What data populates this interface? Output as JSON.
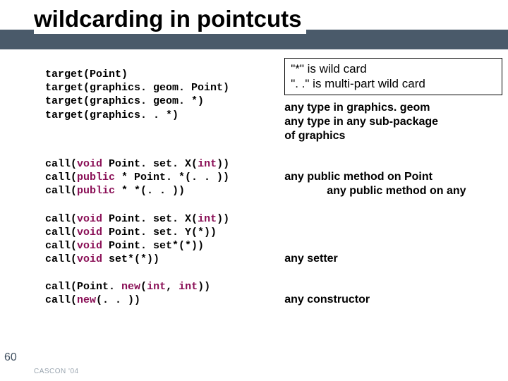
{
  "slide": {
    "title": "wildcarding in pointcuts",
    "number": "60",
    "footer": "CASCON '04"
  },
  "noteBox": {
    "line1a": "\"*\"",
    "line1b": " is wild card",
    "line2a": "\". .\"",
    "line2b": " is multi-part wild card"
  },
  "block1": {
    "code": "target(Point)\ntarget(graphics. geom. Point)\ntarget(graphics. geom. *)\ntarget(graphics. . *)",
    "note": "any type in graphics. geom\nany type in any sub-package\nof graphics"
  },
  "block2": {
    "l1a": "call(",
    "l1b": "void",
    "l1c": " Point. set. X(",
    "l1d": "int",
    "l1e": "))",
    "l2a": "call(",
    "l2b": "public",
    "l2c": " * Point. *(. . ))",
    "l3a": "call(",
    "l3b": "public",
    "l3c": " * *(. . ))",
    "noteLine1": "any public method on Point",
    "noteLine2": "any public method on any"
  },
  "block3": {
    "l1a": "call(",
    "l1b": "void",
    "l1c": " Point. set. X(",
    "l1d": "int",
    "l1e": "))",
    "l2a": "call(",
    "l2b": "void",
    "l2c": " Point. set. Y(*))",
    "l3a": "call(",
    "l3b": "void",
    "l3c": " Point. set*(*))",
    "l4a": "call(",
    "l4b": "void",
    "l4c": " set*(*))",
    "note": "any setter"
  },
  "block4": {
    "l1a": "call(Point. ",
    "l1b": "new",
    "l1c": "(",
    "l1d": "int",
    "l1e": ", ",
    "l1f": "int",
    "l1g": "))",
    "l2a": "call(",
    "l2b": "new",
    "l2c": "(. . ))",
    "note": "any constructor"
  }
}
